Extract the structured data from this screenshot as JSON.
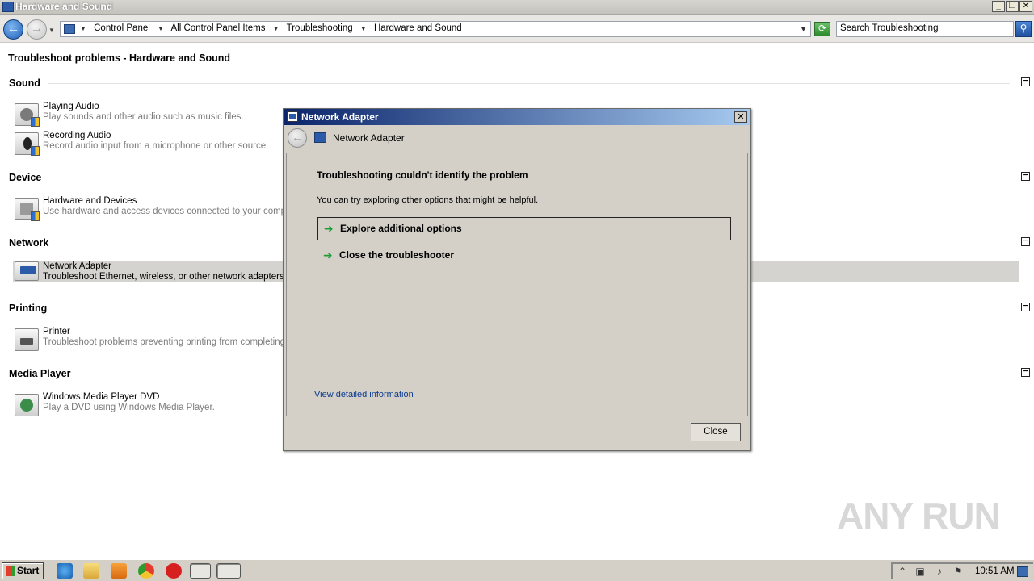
{
  "window": {
    "title": "Hardware and Sound",
    "buttons": {
      "minimize": "_",
      "maximize": "❐",
      "close": "✕"
    }
  },
  "address": {
    "crumbs": [
      "Control Panel",
      "All Control Panel Items",
      "Troubleshooting",
      "Hardware and Sound"
    ],
    "search_placeholder": "Search Troubleshooting"
  },
  "page": {
    "title": "Troubleshoot problems - Hardware and Sound",
    "sections": [
      {
        "heading": "Sound",
        "items": [
          {
            "name": "Playing Audio",
            "desc": "Play sounds and other audio such as music files."
          },
          {
            "name": "Recording Audio",
            "desc": "Record audio input from a microphone or other source."
          }
        ]
      },
      {
        "heading": "Device",
        "items": [
          {
            "name": "Hardware and Devices",
            "desc": "Use hardware and access devices connected to your computer."
          }
        ]
      },
      {
        "heading": "Network",
        "items": [
          {
            "name": "Network Adapter",
            "desc": "Troubleshoot Ethernet, wireless, or other network adapters."
          }
        ]
      },
      {
        "heading": "Printing",
        "items": [
          {
            "name": "Printer",
            "desc": "Troubleshoot problems preventing printing from completing."
          }
        ]
      },
      {
        "heading": "Media Player",
        "items": [
          {
            "name": "Windows Media Player DVD",
            "desc": "Play a DVD using Windows Media Player."
          }
        ]
      }
    ]
  },
  "dialog": {
    "title": "Network Adapter",
    "header_title": "Network Adapter",
    "heading": "Troubleshooting couldn't identify the problem",
    "text": "You can try exploring other options that might be helpful.",
    "options": [
      "Explore additional options",
      "Close the troubleshooter"
    ],
    "link": "View detailed information",
    "close_button": "Close"
  },
  "taskbar": {
    "start": "Start",
    "clock": "10:51 AM"
  },
  "watermark": "ANY RUN",
  "colors": {
    "dialog_title_start": "#0a246a",
    "dialog_title_end": "#a6caf0",
    "option_arrow": "#1f9d33",
    "link": "#0b3a8f",
    "selected_row": "#d5d3cf"
  }
}
